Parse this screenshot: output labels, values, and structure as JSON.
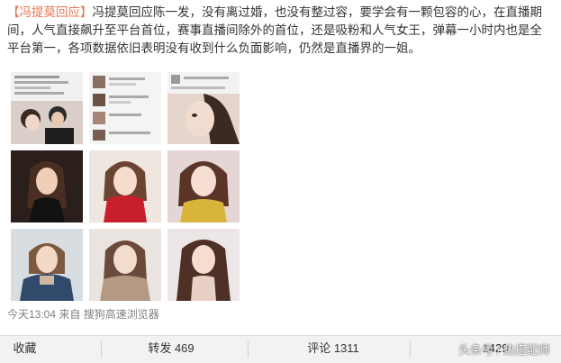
{
  "post": {
    "hashtag": "【冯提莫回应】",
    "body": "冯提莫回应陈一发，没有离过婚，也没有整过容，要学会有一颗包容的心，在直播期间，人气直接飙升至平台首位，赛事直播间除外的首位，还是吸粉和人气女王，弹幕一小时内也是全平台第一，各项数据依旧表明没有收到什么负面影响，仍然是直播界的一姐。"
  },
  "meta": {
    "timestamp": "今天13:04",
    "source": "来自 搜狗高速浏览器"
  },
  "actions": {
    "collect": "收藏",
    "repost": "转发 469",
    "comment": "评论 1311",
    "like": "1429"
  },
  "watermark": "头条号 / 热搭配师",
  "photos": [
    "chat-screenshot-couple",
    "chat-screenshot",
    "selfie-closeup",
    "portrait-dark-background",
    "portrait-red-scarf",
    "portrait-yellow-top",
    "portrait-blue-coat",
    "portrait-beige-coat",
    "portrait-long-hair"
  ]
}
